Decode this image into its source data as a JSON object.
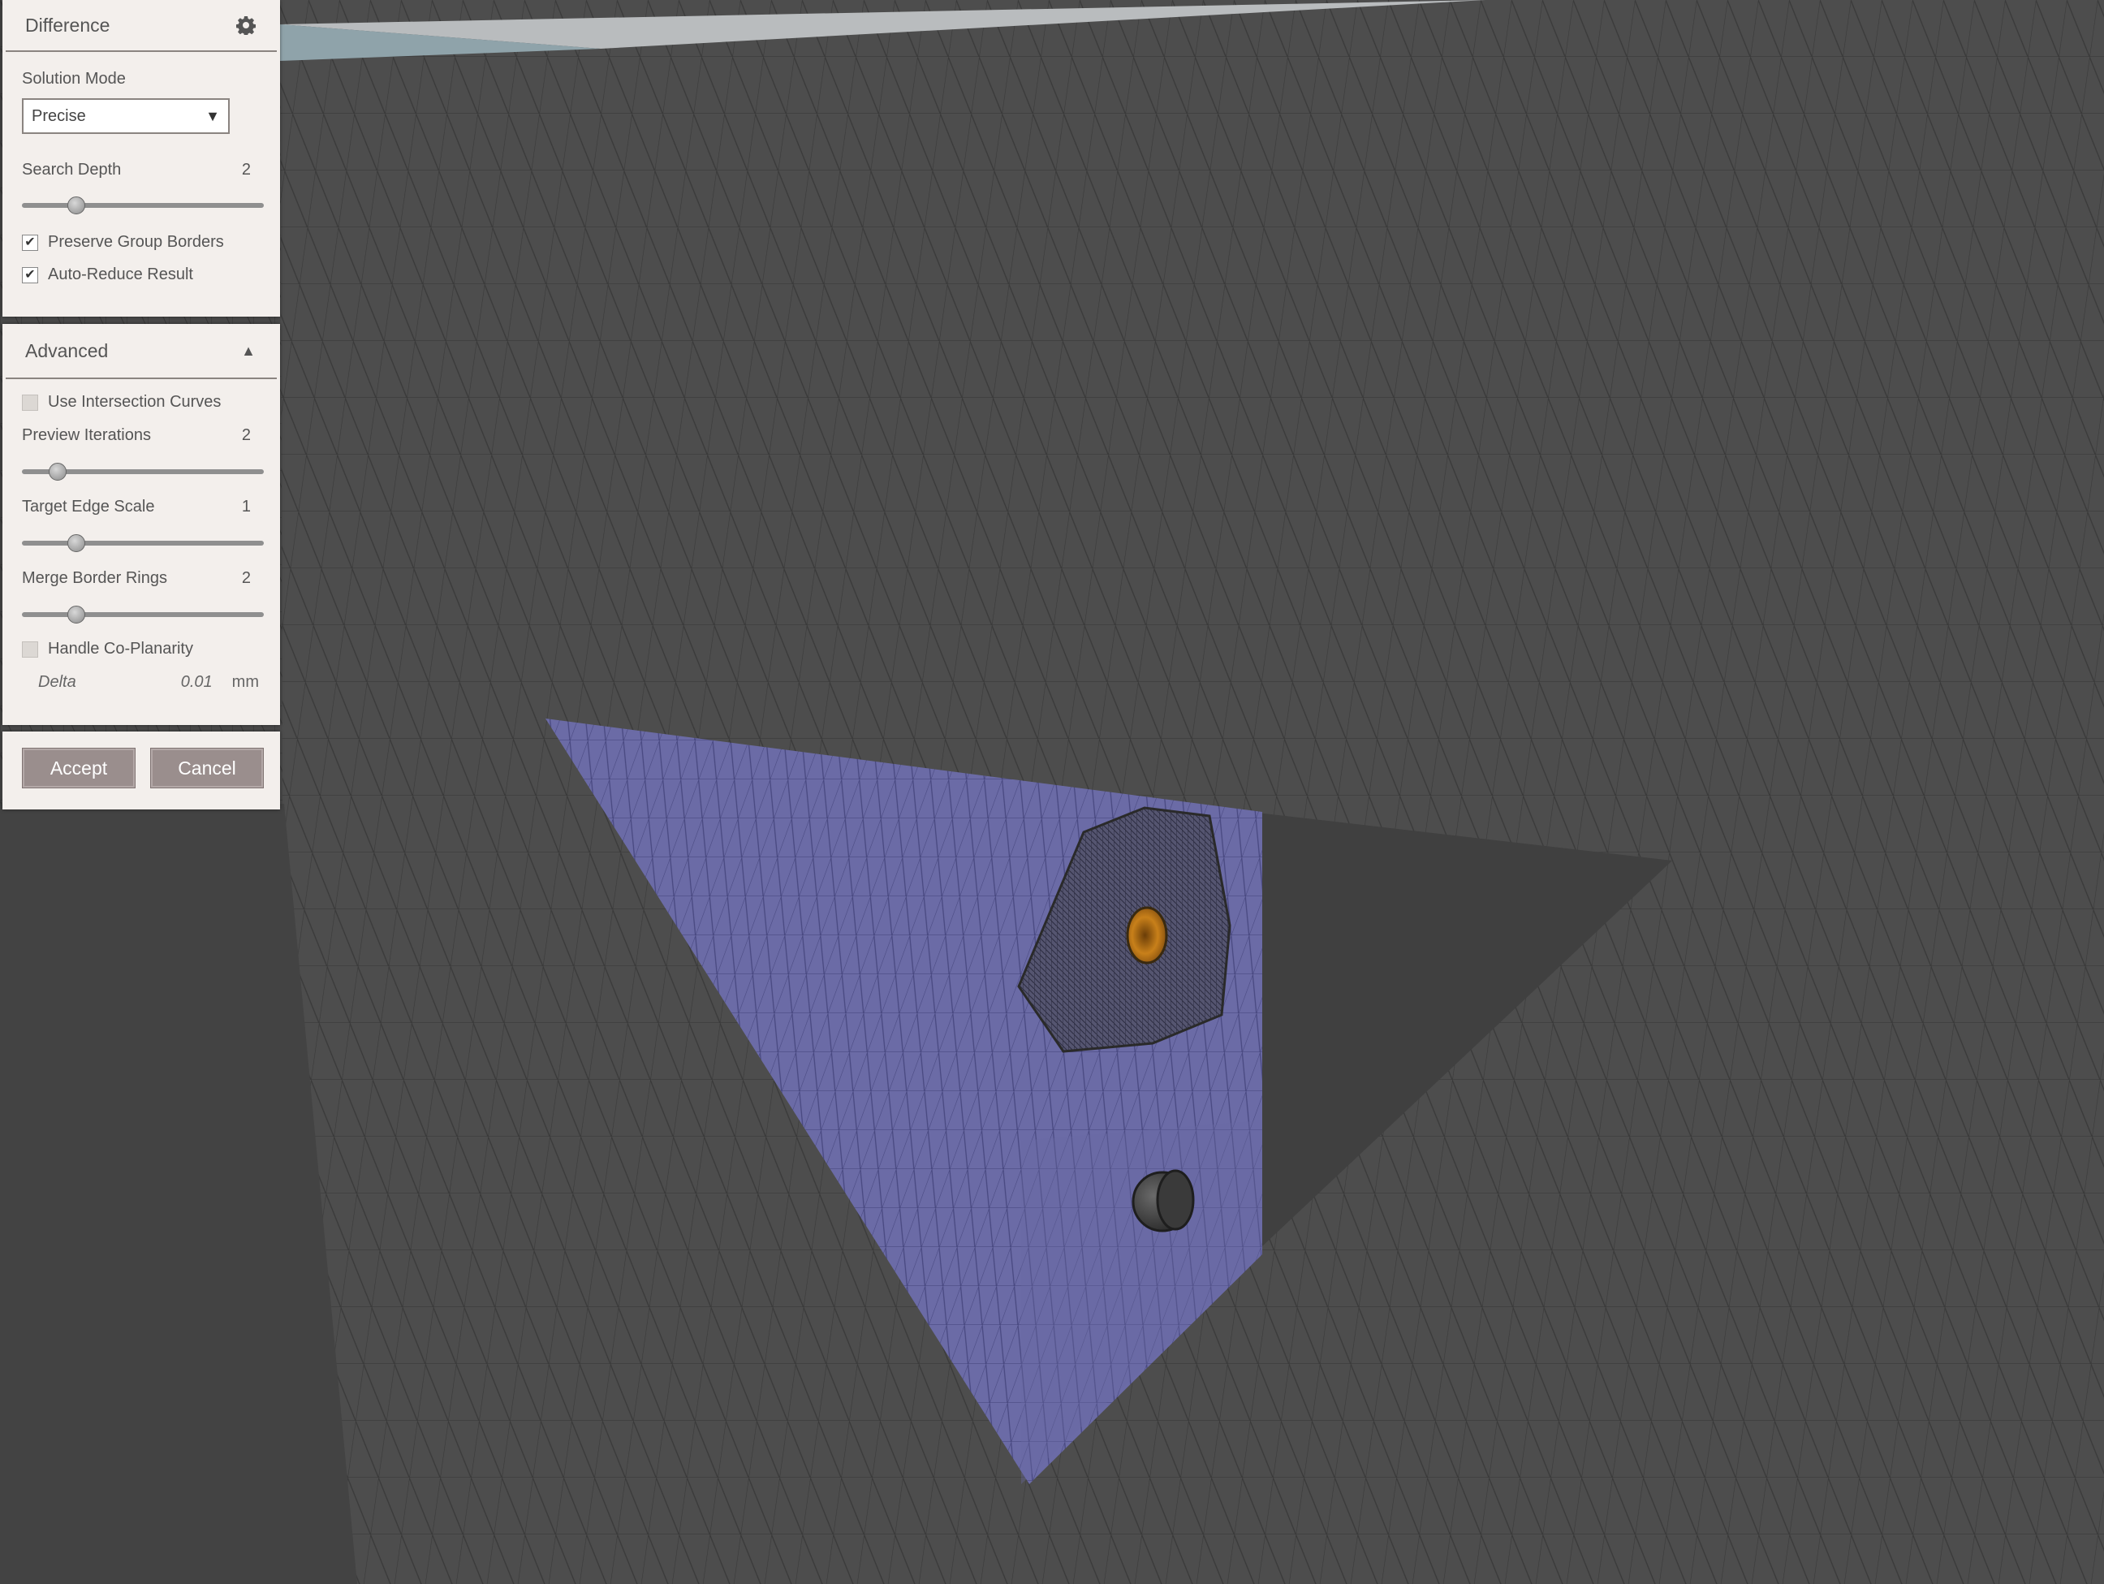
{
  "difference_panel": {
    "title": "Difference",
    "solution_mode_label": "Solution Mode",
    "solution_mode_value": "Precise",
    "search_depth_label": "Search Depth",
    "search_depth_value": "2",
    "search_depth_level": 0.2,
    "preserve_group_borders_label": "Preserve Group Borders",
    "preserve_group_borders_checked": true,
    "auto_reduce_label": "Auto-Reduce Result",
    "auto_reduce_checked": true
  },
  "advanced_panel": {
    "title": "Advanced",
    "use_intersection_curves_label": "Use Intersection Curves",
    "use_intersection_curves_checked": false,
    "preview_iterations_label": "Preview Iterations",
    "preview_iterations_value": "2",
    "preview_iterations_level": 0.12,
    "target_edge_scale_label": "Target Edge Scale",
    "target_edge_scale_value": "1",
    "target_edge_scale_level": 0.2,
    "merge_border_rings_label": "Merge Border Rings",
    "merge_border_rings_value": "2",
    "merge_border_rings_level": 0.2,
    "handle_coplanarity_label": "Handle Co-Planarity",
    "handle_coplanarity_checked": false,
    "delta_label": "Delta",
    "delta_value": "0.01",
    "delta_unit": "mm"
  },
  "actions": {
    "accept_label": "Accept",
    "cancel_label": "Cancel"
  },
  "colors": {
    "panel_bg": "#f3efec",
    "mesh_gray": "#4a4a4a",
    "selection_purple": "#6b6ba6",
    "hole_orange": "#c8801a",
    "button": "#9a8e8d"
  }
}
